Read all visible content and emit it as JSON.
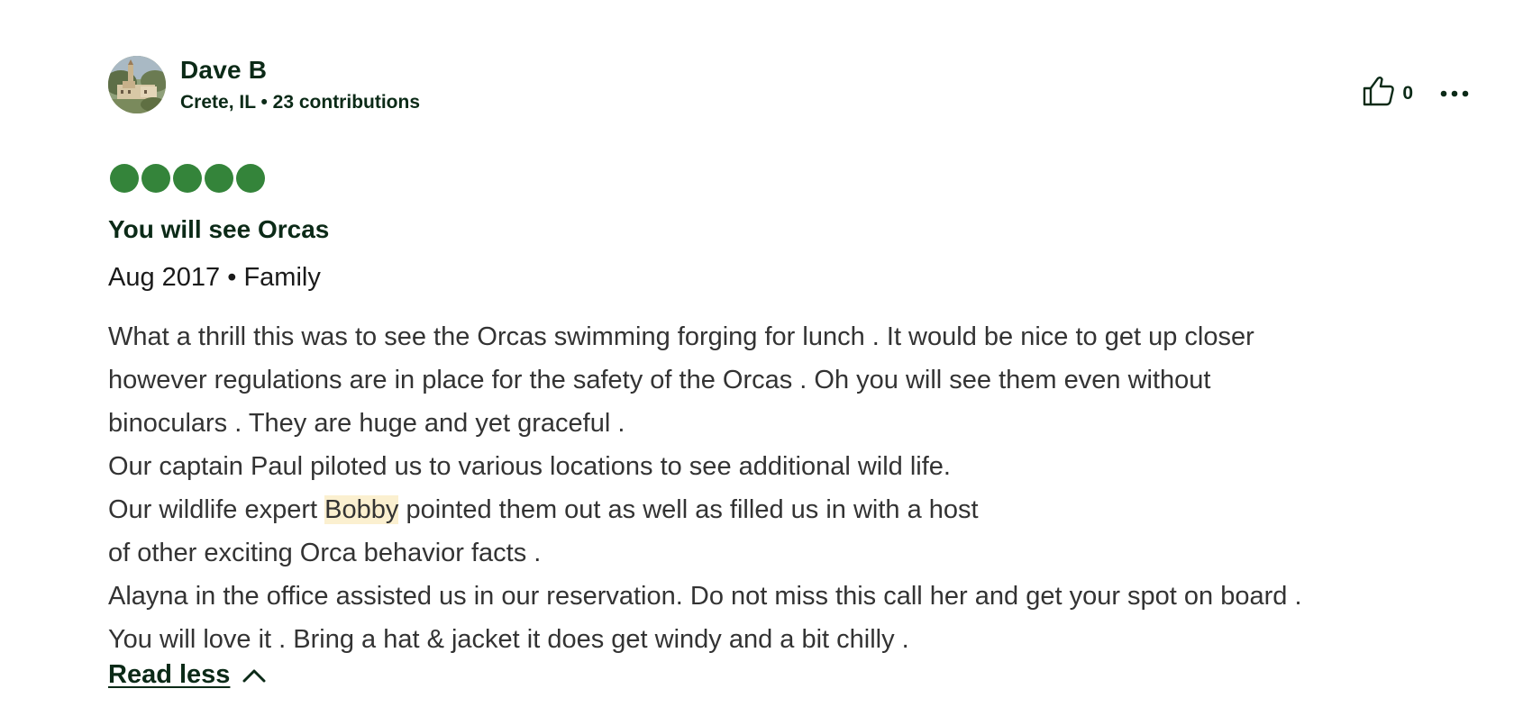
{
  "review": {
    "author": {
      "name": "Dave B",
      "location": "Crete, IL",
      "separator": "•",
      "contributions": "23 contributions",
      "meta": "Crete, IL • 23 contributions",
      "avatar_icon": "avatar-photo"
    },
    "helpful": {
      "icon": "thumbs-up-icon",
      "count": "0"
    },
    "more_icon": "more-options-icon",
    "rating": {
      "value": 5,
      "max": 5,
      "color": "#34843a"
    },
    "title": "You will see Orcas",
    "trip_info": "Aug 2017 • Family",
    "body": {
      "line1": "What a thrill this was to see the Orcas swimming forging for lunch . It would be nice to get up closer",
      "line2": "however regulations are in place for the safety of the Orcas . Oh you will see them even without",
      "line3": "binoculars . They are huge and yet graceful .",
      "line4": "Our captain Paul piloted us to various locations to see additional wild life.",
      "line5_before": "Our wildlife expert ",
      "line5_highlight": "Bobby",
      "line5_after": " pointed them out as well as filled us in with a host",
      "line6": "of other exciting Orca behavior facts .",
      "line7": "Alayna in the office assisted us in our reservation. Do not miss this call her and get your spot on board .",
      "line8": "You will love it . Bring a hat & jacket it does get windy and a bit chilly ."
    },
    "read_less": {
      "label": "Read less",
      "icon": "chevron-up-icon"
    }
  },
  "colors": {
    "brand_dark": "#0b2a17",
    "bubble_green": "#34843a",
    "highlight": "#fbf0d0",
    "body_text": "#333333"
  }
}
